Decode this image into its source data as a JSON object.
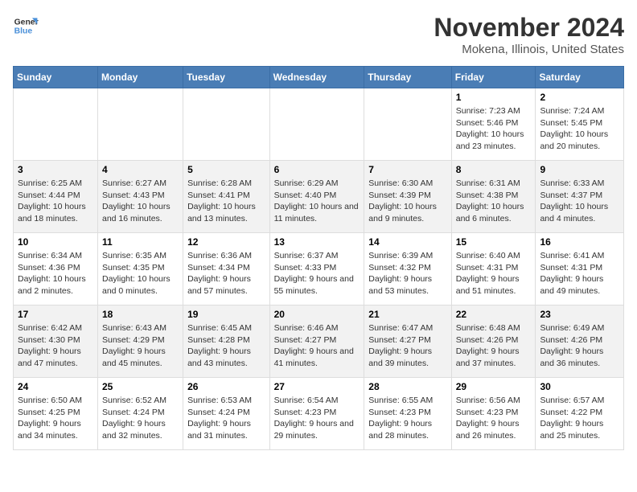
{
  "logo": {
    "line1": "General",
    "line2": "Blue"
  },
  "title": "November 2024",
  "subtitle": "Mokena, Illinois, United States",
  "days_of_week": [
    "Sunday",
    "Monday",
    "Tuesday",
    "Wednesday",
    "Thursday",
    "Friday",
    "Saturday"
  ],
  "weeks": [
    [
      {
        "day": "",
        "info": ""
      },
      {
        "day": "",
        "info": ""
      },
      {
        "day": "",
        "info": ""
      },
      {
        "day": "",
        "info": ""
      },
      {
        "day": "",
        "info": ""
      },
      {
        "day": "1",
        "info": "Sunrise: 7:23 AM\nSunset: 5:46 PM\nDaylight: 10 hours and 23 minutes."
      },
      {
        "day": "2",
        "info": "Sunrise: 7:24 AM\nSunset: 5:45 PM\nDaylight: 10 hours and 20 minutes."
      }
    ],
    [
      {
        "day": "3",
        "info": "Sunrise: 6:25 AM\nSunset: 4:44 PM\nDaylight: 10 hours and 18 minutes."
      },
      {
        "day": "4",
        "info": "Sunrise: 6:27 AM\nSunset: 4:43 PM\nDaylight: 10 hours and 16 minutes."
      },
      {
        "day": "5",
        "info": "Sunrise: 6:28 AM\nSunset: 4:41 PM\nDaylight: 10 hours and 13 minutes."
      },
      {
        "day": "6",
        "info": "Sunrise: 6:29 AM\nSunset: 4:40 PM\nDaylight: 10 hours and 11 minutes."
      },
      {
        "day": "7",
        "info": "Sunrise: 6:30 AM\nSunset: 4:39 PM\nDaylight: 10 hours and 9 minutes."
      },
      {
        "day": "8",
        "info": "Sunrise: 6:31 AM\nSunset: 4:38 PM\nDaylight: 10 hours and 6 minutes."
      },
      {
        "day": "9",
        "info": "Sunrise: 6:33 AM\nSunset: 4:37 PM\nDaylight: 10 hours and 4 minutes."
      }
    ],
    [
      {
        "day": "10",
        "info": "Sunrise: 6:34 AM\nSunset: 4:36 PM\nDaylight: 10 hours and 2 minutes."
      },
      {
        "day": "11",
        "info": "Sunrise: 6:35 AM\nSunset: 4:35 PM\nDaylight: 10 hours and 0 minutes."
      },
      {
        "day": "12",
        "info": "Sunrise: 6:36 AM\nSunset: 4:34 PM\nDaylight: 9 hours and 57 minutes."
      },
      {
        "day": "13",
        "info": "Sunrise: 6:37 AM\nSunset: 4:33 PM\nDaylight: 9 hours and 55 minutes."
      },
      {
        "day": "14",
        "info": "Sunrise: 6:39 AM\nSunset: 4:32 PM\nDaylight: 9 hours and 53 minutes."
      },
      {
        "day": "15",
        "info": "Sunrise: 6:40 AM\nSunset: 4:31 PM\nDaylight: 9 hours and 51 minutes."
      },
      {
        "day": "16",
        "info": "Sunrise: 6:41 AM\nSunset: 4:31 PM\nDaylight: 9 hours and 49 minutes."
      }
    ],
    [
      {
        "day": "17",
        "info": "Sunrise: 6:42 AM\nSunset: 4:30 PM\nDaylight: 9 hours and 47 minutes."
      },
      {
        "day": "18",
        "info": "Sunrise: 6:43 AM\nSunset: 4:29 PM\nDaylight: 9 hours and 45 minutes."
      },
      {
        "day": "19",
        "info": "Sunrise: 6:45 AM\nSunset: 4:28 PM\nDaylight: 9 hours and 43 minutes."
      },
      {
        "day": "20",
        "info": "Sunrise: 6:46 AM\nSunset: 4:27 PM\nDaylight: 9 hours and 41 minutes."
      },
      {
        "day": "21",
        "info": "Sunrise: 6:47 AM\nSunset: 4:27 PM\nDaylight: 9 hours and 39 minutes."
      },
      {
        "day": "22",
        "info": "Sunrise: 6:48 AM\nSunset: 4:26 PM\nDaylight: 9 hours and 37 minutes."
      },
      {
        "day": "23",
        "info": "Sunrise: 6:49 AM\nSunset: 4:26 PM\nDaylight: 9 hours and 36 minutes."
      }
    ],
    [
      {
        "day": "24",
        "info": "Sunrise: 6:50 AM\nSunset: 4:25 PM\nDaylight: 9 hours and 34 minutes."
      },
      {
        "day": "25",
        "info": "Sunrise: 6:52 AM\nSunset: 4:24 PM\nDaylight: 9 hours and 32 minutes."
      },
      {
        "day": "26",
        "info": "Sunrise: 6:53 AM\nSunset: 4:24 PM\nDaylight: 9 hours and 31 minutes."
      },
      {
        "day": "27",
        "info": "Sunrise: 6:54 AM\nSunset: 4:23 PM\nDaylight: 9 hours and 29 minutes."
      },
      {
        "day": "28",
        "info": "Sunrise: 6:55 AM\nSunset: 4:23 PM\nDaylight: 9 hours and 28 minutes."
      },
      {
        "day": "29",
        "info": "Sunrise: 6:56 AM\nSunset: 4:23 PM\nDaylight: 9 hours and 26 minutes."
      },
      {
        "day": "30",
        "info": "Sunrise: 6:57 AM\nSunset: 4:22 PM\nDaylight: 9 hours and 25 minutes."
      }
    ]
  ]
}
